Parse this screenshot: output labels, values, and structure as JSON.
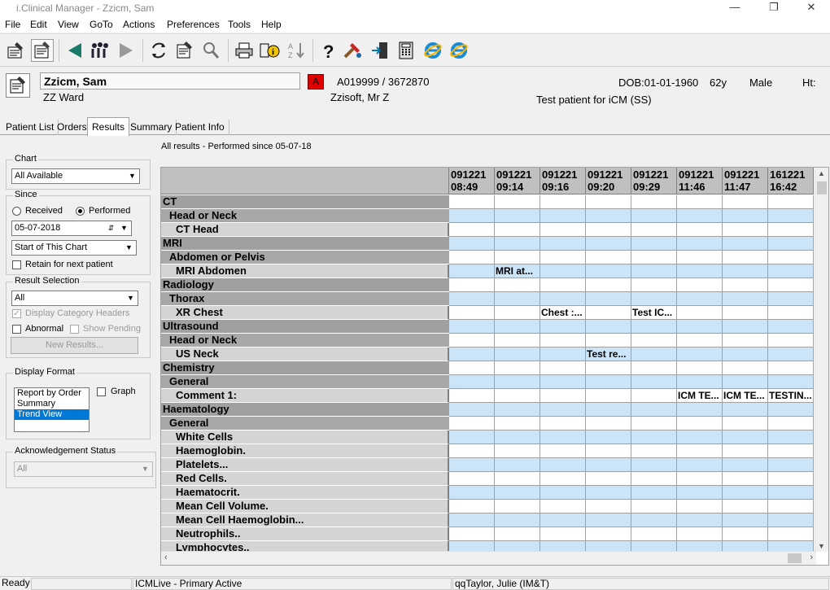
{
  "window": {
    "title": "i.Clinical Manager - Zzicm, Sam"
  },
  "menu": [
    "File",
    "Edit",
    "View",
    "GoTo",
    "Actions",
    "Preferences",
    "Tools",
    "Help"
  ],
  "patient": {
    "name": "Zzicm, Sam",
    "ward": "ZZ Ward",
    "alert": "A",
    "ids": "A019999 / 3672870",
    "consultant": "Zzisoft, Mr Z",
    "dob": "DOB:01-01-1960",
    "age": "62y",
    "sex": "Male",
    "height_label": "Ht:",
    "note": "Test patient for iCM (SS)"
  },
  "tabs": [
    "Patient List",
    "Orders",
    "Results",
    "Summary",
    "Patient Info"
  ],
  "active_tab": "Results",
  "left": {
    "chart_label": "Chart",
    "chart_value": "All Available",
    "since_label": "Since",
    "received_label": "Received",
    "performed_label": "Performed",
    "date_value": "05-07-2018",
    "since_select": "Start of This Chart",
    "retain_label": "Retain for next patient",
    "result_selection_label": "Result Selection",
    "result_selection_value": "All",
    "display_category_headers": "Display Category Headers",
    "abnormal_label": "Abnormal",
    "show_pending_label": "Show Pending",
    "new_results_button": "New Results...",
    "display_format_label": "Display Format",
    "format_options": [
      "Report by Order",
      "Summary",
      "Trend View"
    ],
    "format_selected": "Trend View",
    "graph_label": "Graph",
    "ack_status_label": "Acknowledgement Status",
    "ack_status_value": "All"
  },
  "results_caption": "All results - Performed since 05-07-18",
  "grid": {
    "columns": [
      {
        "date": "091221",
        "time": "08:49"
      },
      {
        "date": "091221",
        "time": "09:14"
      },
      {
        "date": "091221",
        "time": "09:16"
      },
      {
        "date": "091221",
        "time": "09:20"
      },
      {
        "date": "091221",
        "time": "09:29"
      },
      {
        "date": "091221",
        "time": "11:46"
      },
      {
        "date": "091221",
        "time": "11:47"
      },
      {
        "date": "161221",
        "time": "16:42"
      }
    ],
    "rows": [
      {
        "label": "CT",
        "level": 0,
        "cells": [
          "",
          "",
          "",
          "",
          "",
          "",
          "",
          ""
        ]
      },
      {
        "label": "Head or Neck",
        "level": 1,
        "cells": [
          "",
          "",
          "",
          "",
          "",
          "",
          "",
          ""
        ]
      },
      {
        "label": "CT Head",
        "level": 2,
        "cells": [
          "",
          "",
          "",
          "",
          "",
          "",
          "",
          ""
        ]
      },
      {
        "label": "MRI",
        "level": 0,
        "cells": [
          "",
          "",
          "",
          "",
          "",
          "",
          "",
          ""
        ]
      },
      {
        "label": "Abdomen or Pelvis",
        "level": 1,
        "cells": [
          "",
          "",
          "",
          "",
          "",
          "",
          "",
          ""
        ]
      },
      {
        "label": "MRI Abdomen",
        "level": 2,
        "cells": [
          "",
          "MRI at...",
          "",
          "",
          "",
          "",
          "",
          ""
        ]
      },
      {
        "label": "Radiology",
        "level": 0,
        "cells": [
          "",
          "",
          "",
          "",
          "",
          "",
          "",
          ""
        ]
      },
      {
        "label": "Thorax",
        "level": 1,
        "cells": [
          "",
          "",
          "",
          "",
          "",
          "",
          "",
          ""
        ]
      },
      {
        "label": "XR Chest",
        "level": 2,
        "cells": [
          "",
          "",
          "Chest :...",
          "",
          "Test IC...",
          "",
          "",
          ""
        ]
      },
      {
        "label": "Ultrasound",
        "level": 0,
        "cells": [
          "",
          "",
          "",
          "",
          "",
          "",
          "",
          ""
        ]
      },
      {
        "label": "Head or Neck",
        "level": 1,
        "cells": [
          "",
          "",
          "",
          "",
          "",
          "",
          "",
          ""
        ]
      },
      {
        "label": "US Neck",
        "level": 2,
        "cells": [
          "",
          "",
          "",
          "Test re...",
          "",
          "",
          "",
          ""
        ]
      },
      {
        "label": "Chemistry",
        "level": 0,
        "cells": [
          "",
          "",
          "",
          "",
          "",
          "",
          "",
          ""
        ]
      },
      {
        "label": "General",
        "level": 1,
        "cells": [
          "",
          "",
          "",
          "",
          "",
          "",
          "",
          ""
        ]
      },
      {
        "label": "Comment 1:",
        "level": 2,
        "cells": [
          "",
          "",
          "",
          "",
          "",
          "ICM TE...",
          "ICM TE...",
          "TESTIN..."
        ]
      },
      {
        "label": "Haematology",
        "level": 0,
        "cells": [
          "",
          "",
          "",
          "",
          "",
          "",
          "",
          ""
        ]
      },
      {
        "label": "General",
        "level": 1,
        "cells": [
          "",
          "",
          "",
          "",
          "",
          "",
          "",
          ""
        ]
      },
      {
        "label": "White Cells",
        "level": 2,
        "cells": [
          "",
          "",
          "",
          "",
          "",
          "",
          "",
          ""
        ]
      },
      {
        "label": "Haemoglobin.",
        "level": 2,
        "cells": [
          "",
          "",
          "",
          "",
          "",
          "",
          "",
          ""
        ]
      },
      {
        "label": "Platelets...",
        "level": 2,
        "cells": [
          "",
          "",
          "",
          "",
          "",
          "",
          "",
          ""
        ]
      },
      {
        "label": "Red Cells.",
        "level": 2,
        "cells": [
          "",
          "",
          "",
          "",
          "",
          "",
          "",
          ""
        ]
      },
      {
        "label": "Haematocrit.",
        "level": 2,
        "cells": [
          "",
          "",
          "",
          "",
          "",
          "",
          "",
          ""
        ]
      },
      {
        "label": "Mean Cell Volume.",
        "level": 2,
        "cells": [
          "",
          "",
          "",
          "",
          "",
          "",
          "",
          ""
        ]
      },
      {
        "label": "Mean Cell Haemoglobin...",
        "level": 2,
        "cells": [
          "",
          "",
          "",
          "",
          "",
          "",
          "",
          ""
        ]
      },
      {
        "label": "Neutrophils..",
        "level": 2,
        "cells": [
          "",
          "",
          "",
          "",
          "",
          "",
          "",
          ""
        ]
      },
      {
        "label": "Lymphocytes..",
        "level": 2,
        "cells": [
          "",
          "",
          "",
          "",
          "",
          "",
          "",
          ""
        ]
      }
    ]
  },
  "status": {
    "ready": "Ready",
    "connection": "ICMLive - Primary Active",
    "user": "qqTaylor, Julie (IM&T)"
  },
  "colors": {
    "cell_blue": "#cce4f7",
    "alert_red": "#e00000",
    "selection": "#0078d7"
  }
}
